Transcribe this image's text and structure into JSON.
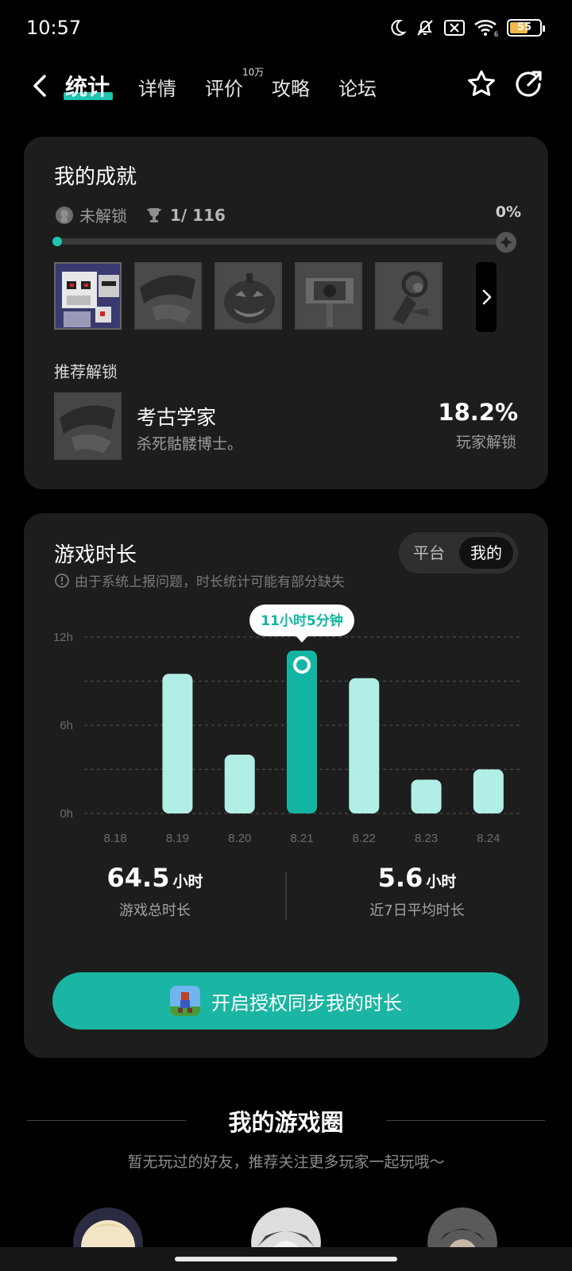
{
  "status_bar": {
    "time": "10:57",
    "battery": "55",
    "wifi_suffix": "6"
  },
  "nav": {
    "tabs": [
      {
        "label": "统计",
        "active": true
      },
      {
        "label": "详情"
      },
      {
        "label": "评价"
      },
      {
        "label": "攻略"
      },
      {
        "label": "论坛"
      }
    ],
    "review_badge": "10万"
  },
  "achievements": {
    "title": "我的成就",
    "locked_label": "未解锁",
    "count": "1/ 116",
    "percent": "0%",
    "progress": 0.0,
    "recommend_label": "推荐解锁",
    "recommended": {
      "name": "考古学家",
      "desc": "杀死骷髅博士。",
      "percent": "18.2%",
      "percent_label": "玩家解锁"
    }
  },
  "playtime": {
    "title": "游戏时长",
    "toggle": {
      "platform": "平台",
      "mine": "我的"
    },
    "notice": "由于系统上报问题，时长统计可能有部分缺失",
    "tooltip": "11小时5分钟",
    "total": {
      "value": "64.5",
      "unit": "小时",
      "label": "游戏总时长"
    },
    "average": {
      "value": "5.6",
      "unit": "小时",
      "label": "近7日平均时长"
    },
    "sync_button": "开启授权同步我的时长"
  },
  "chart_data": {
    "type": "bar",
    "categories": [
      "8.18",
      "8.19",
      "8.20",
      "8.21",
      "8.22",
      "8.23",
      "8.24"
    ],
    "values": [
      0,
      9.5,
      4.0,
      11.08,
      9.2,
      2.3,
      3.0
    ],
    "y_ticks": [
      "12h",
      "6h",
      "0h"
    ],
    "ylim": [
      0,
      12
    ],
    "highlight_index": 3,
    "colors": {
      "bar": "#b1efe6",
      "highlight": "#12b5a3",
      "grid": "#4a4a4a"
    }
  },
  "circle": {
    "title": "我的游戏圈",
    "subtitle": "暂无玩过的好友，推荐关注更多玩家一起玩哦～"
  }
}
